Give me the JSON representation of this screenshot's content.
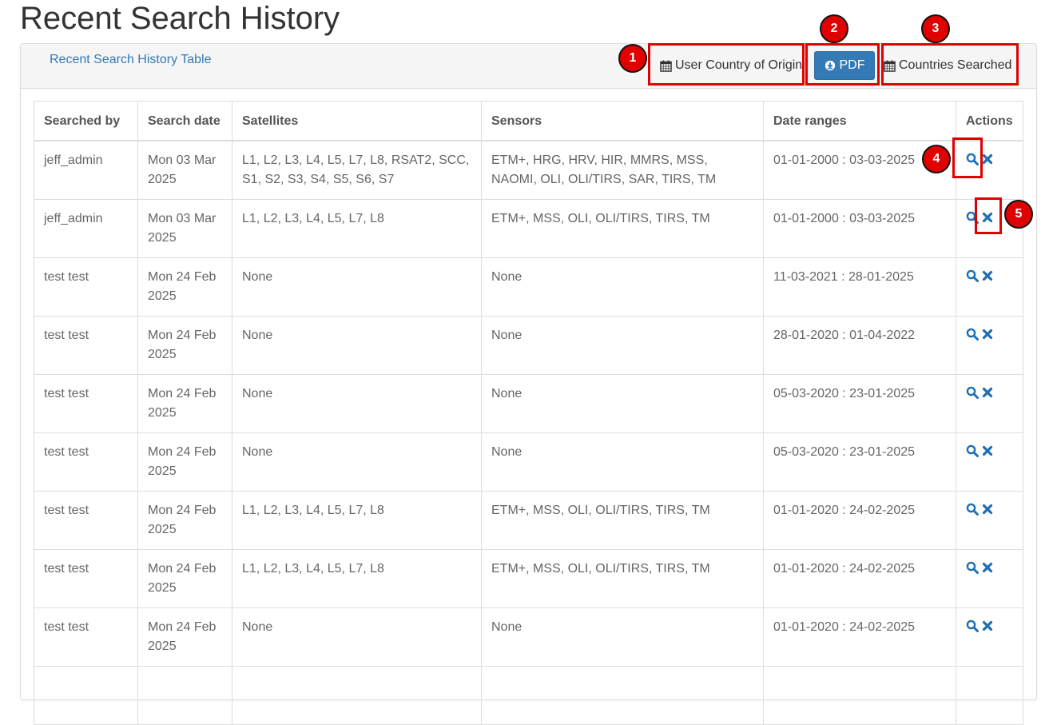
{
  "page": {
    "title": "Recent Search History"
  },
  "panel": {
    "heading_link": "Recent Search History Table",
    "buttons": {
      "user_country_label": "User Country of Origin",
      "pdf_label": "PDF",
      "countries_searched_label": "Countries Searched"
    }
  },
  "annotations": [
    "1",
    "2",
    "3",
    "4",
    "5"
  ],
  "table": {
    "headers": [
      "Searched by",
      "Search date",
      "Satellites",
      "Sensors",
      "Date ranges",
      "Actions"
    ],
    "rows": [
      {
        "searched_by": "jeff_admin",
        "search_date": "Mon 03 Mar 2025",
        "satellites": "L1, L2, L3, L4, L5, L7, L8, RSAT2, SCC, S1, S2, S3, S4, S5, S6, S7",
        "sensors": "ETM+, HRG, HRV, HIR, MMRS, MSS, NAOMI, OLI, OLI/TIRS, SAR, TIRS, TM",
        "date_range": "01-01-2000 : 03-03-2025"
      },
      {
        "searched_by": "jeff_admin",
        "search_date": "Mon 03 Mar 2025",
        "satellites": "L1, L2, L3, L4, L5, L7, L8",
        "sensors": "ETM+, MSS, OLI, OLI/TIRS, TIRS, TM",
        "date_range": "01-01-2000 : 03-03-2025"
      },
      {
        "searched_by": "test test",
        "search_date": "Mon 24 Feb 2025",
        "satellites": "None",
        "sensors": "None",
        "date_range": "11-03-2021 : 28-01-2025"
      },
      {
        "searched_by": "test test",
        "search_date": "Mon 24 Feb 2025",
        "satellites": "None",
        "sensors": "None",
        "date_range": "28-01-2020 : 01-04-2022"
      },
      {
        "searched_by": "test test",
        "search_date": "Mon 24 Feb 2025",
        "satellites": "None",
        "sensors": "None",
        "date_range": "05-03-2020 : 23-01-2025"
      },
      {
        "searched_by": "test test",
        "search_date": "Mon 24 Feb 2025",
        "satellites": "None",
        "sensors": "None",
        "date_range": "05-03-2020 : 23-01-2025"
      },
      {
        "searched_by": "test test",
        "search_date": "Mon 24 Feb 2025",
        "satellites": "L1, L2, L3, L4, L5, L7, L8",
        "sensors": "ETM+, MSS, OLI, OLI/TIRS, TIRS, TM",
        "date_range": "01-01-2020 : 24-02-2025"
      },
      {
        "searched_by": "test test",
        "search_date": "Mon 24 Feb 2025",
        "satellites": "L1, L2, L3, L4, L5, L7, L8",
        "sensors": "ETM+, MSS, OLI, OLI/TIRS, TIRS, TM",
        "date_range": "01-01-2020 : 24-02-2025"
      },
      {
        "searched_by": "test test",
        "search_date": "Mon 24 Feb 2025",
        "satellites": "None",
        "sensors": "None",
        "date_range": "01-01-2020 : 24-02-2025"
      },
      {
        "searched_by": "",
        "search_date": "",
        "satellites": "",
        "sensors": "",
        "date_range": ""
      }
    ]
  },
  "colors": {
    "link": "#337ab7",
    "primary_button": "#337ab7",
    "highlight": "#e00000"
  },
  "icons": {
    "calendar": "calendar-icon",
    "download": "download-icon",
    "view": "search-icon",
    "delete": "delete-icon"
  }
}
